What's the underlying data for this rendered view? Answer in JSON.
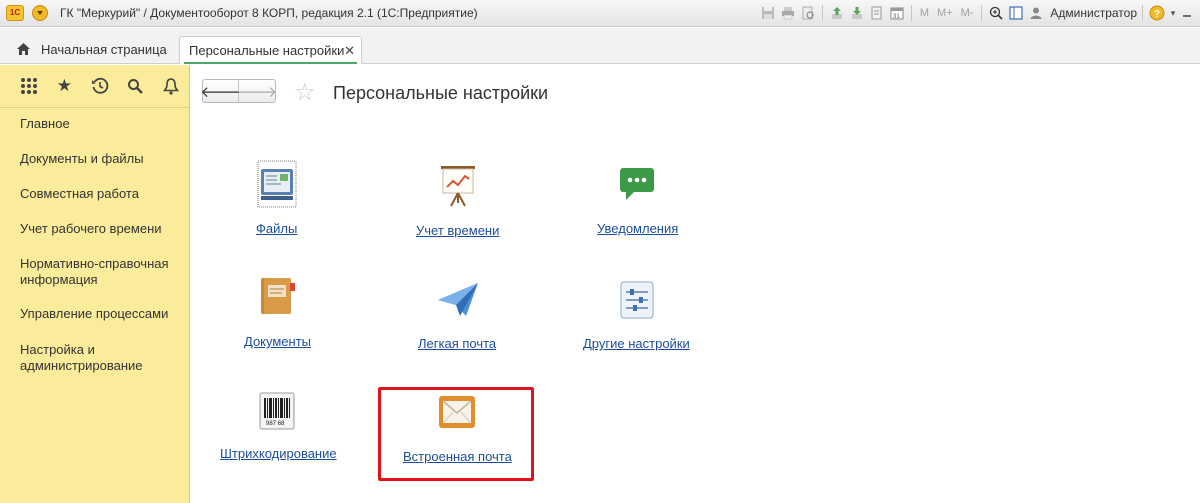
{
  "window": {
    "logo": "1С",
    "title": "ГК \"Меркурий\" / Документооборот 8 КОРП, редакция 2.1  (1С:Предприятие)",
    "toolbar": {
      "m_label": "M",
      "m_plus_label": "M+",
      "m_minus_label": "M-",
      "calendar_day": "31"
    },
    "user": "Администратор"
  },
  "tabs": [
    {
      "label": "Начальная страница",
      "icon": "home-icon"
    },
    {
      "label": "Персональные настройки",
      "icon": "close-icon"
    }
  ],
  "sidebar": {
    "tools": [
      "apps-grid-icon",
      "favorites-star-icon",
      "history-icon",
      "search-icon",
      "notifications-bell-icon"
    ],
    "items": [
      {
        "label": "Главное"
      },
      {
        "label": "Документы и файлы"
      },
      {
        "label": "Совместная работа"
      },
      {
        "label": "Учет рабочего времени"
      },
      {
        "label": "Нормативно-справочная информация"
      },
      {
        "label": "Управление процессами"
      },
      {
        "label": "Настройка и администрирование"
      }
    ]
  },
  "main": {
    "title": "Персональные настройки",
    "tiles": [
      {
        "label": "Файлы",
        "icon": "files-icon"
      },
      {
        "label": "Учет времени",
        "icon": "time-tracking-icon"
      },
      {
        "label": "Уведомления",
        "icon": "notifications-icon"
      },
      {
        "label": "Документы",
        "icon": "documents-icon"
      },
      {
        "label": "Легкая почта",
        "icon": "paper-plane-icon"
      },
      {
        "label": "Другие настройки",
        "icon": "other-settings-icon"
      },
      {
        "label": "Штрихкодирование",
        "icon": "barcode-icon",
        "barcode_digits": "987 68"
      },
      {
        "label": "Встроенная почта",
        "icon": "envelope-icon"
      }
    ],
    "highlight_color": "#e0121a"
  },
  "colors": {
    "sidebar_bg": "#fbec9b",
    "link": "#1b4d9a",
    "tab_accent": "#4aa86b"
  }
}
